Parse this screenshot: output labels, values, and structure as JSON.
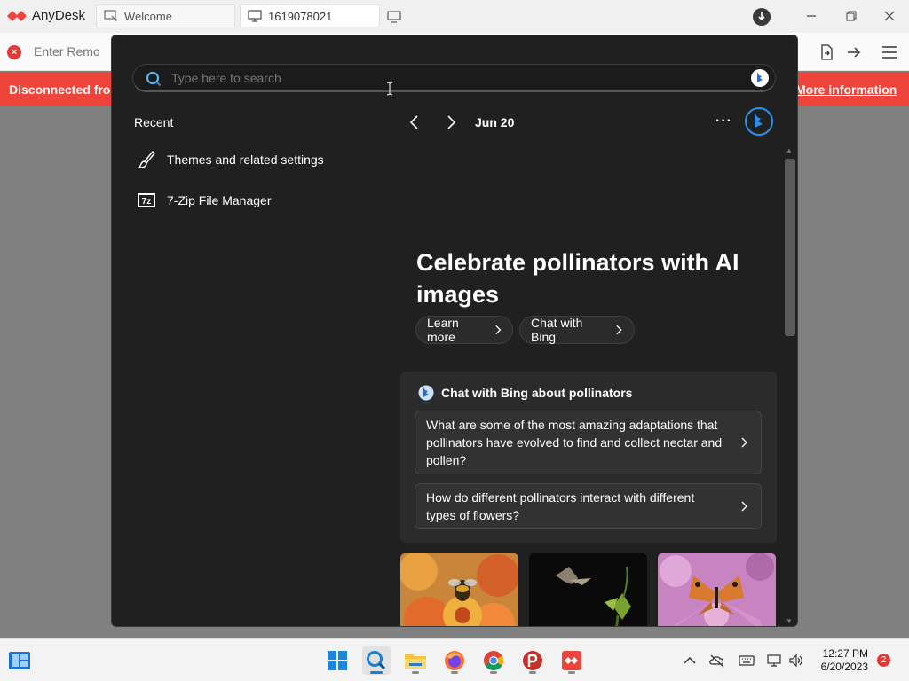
{
  "anydesk": {
    "app_title": "AnyDesk",
    "tabs": [
      {
        "label": "Welcome",
        "icon": "welcome-icon"
      },
      {
        "label": "1619078021",
        "icon": "monitor-icon"
      }
    ],
    "address_placeholder": "Enter Remo",
    "banner_left": "Disconnected fro",
    "banner_right": "More information",
    "brand_color": "#ef443b"
  },
  "flyout": {
    "search_placeholder": "Type here to search",
    "recent_title": "Recent",
    "recent_items": [
      {
        "label": "Themes and related settings",
        "icon": "paintbrush-icon"
      },
      {
        "label": "7-Zip File Manager",
        "icon": "7zip-icon",
        "icon_text": "7z"
      }
    ],
    "date": "Jun 20",
    "more": "···",
    "headline": "Celebrate pollinators with AI images",
    "buttons": [
      {
        "label": "Learn more"
      },
      {
        "label": "Chat with Bing"
      }
    ],
    "chat_card": {
      "title": "Chat with Bing about pollinators",
      "questions": [
        "What are some of the most amazing adaptations that pollinators have evolved to find and collect nectar and pollen?",
        "How do different pollinators interact with different types of flowers?"
      ]
    },
    "images": [
      {
        "name": "bee-on-flowers-image"
      },
      {
        "name": "bat-at-flower-image"
      },
      {
        "name": "butterfly-on-flower-image"
      }
    ]
  },
  "taskbar": {
    "time": "12:27 PM",
    "date": "6/20/2023",
    "notifications": "2"
  }
}
